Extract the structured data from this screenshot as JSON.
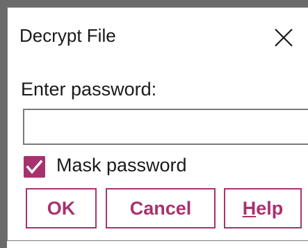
{
  "dialog": {
    "title": "Decrypt File",
    "prompt": "Enter password:",
    "password_value": "",
    "mask": {
      "label": "Mask password",
      "checked": true
    },
    "buttons": {
      "ok": "OK",
      "cancel": "Cancel",
      "help_mnemonic": "H",
      "help_rest": "elp"
    },
    "close_icon": "close-icon"
  },
  "colors": {
    "accent": "#a8326e",
    "frame": "#6b6b6b",
    "border": "#7a7a7a",
    "text": "#1a1a1a"
  }
}
